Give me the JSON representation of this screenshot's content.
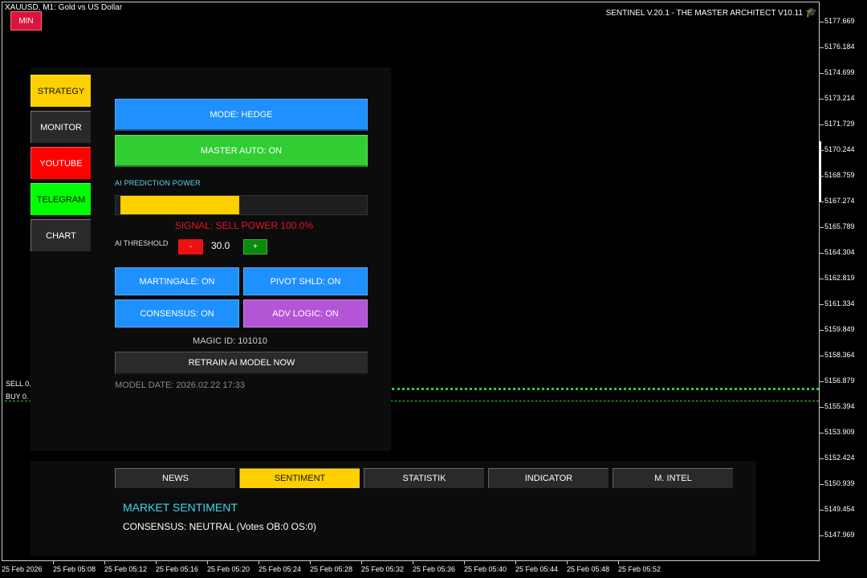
{
  "header": {
    "symbol": "XAUUSD, M1:  Gold vs US Dollar",
    "title": "SENTINEL V.20.1 - THE MASTER ARCHITECT V10.11",
    "title_icon": "graduation-cap-icon",
    "min_label": "MIN"
  },
  "price_axis": [
    "5177.669",
    "5176.184",
    "5174.699",
    "5173.214",
    "5171.729",
    "5170.244",
    "5168.759",
    "5167.274",
    "5165.789",
    "5164.304",
    "5162.819",
    "5161.334",
    "5159.849",
    "5158.364",
    "5156.879",
    "5155.394",
    "5153.909",
    "5152.424",
    "5150.939",
    "5149.454",
    "5147.969"
  ],
  "time_axis": [
    "25 Feb 2026",
    "25 Feb 05:08",
    "25 Feb 05:12",
    "25 Feb 05:16",
    "25 Feb 05:20",
    "25 Feb 05:24",
    "25 Feb 05:28",
    "25 Feb 05:32",
    "25 Feb 05:36",
    "25 Feb 05:40",
    "25 Feb 05:44",
    "25 Feb 05:48",
    "25 Feb 05:52"
  ],
  "chart_lines": {
    "sell_label": "SELL 0.",
    "buy_label": "BUY 0."
  },
  "sidebar": {
    "items": [
      {
        "label": "STRATEGY",
        "bg": "#ffd000",
        "fg": "#111111"
      },
      {
        "label": "MONITOR",
        "bg": "#2a2a2a",
        "fg": "#ffffff"
      },
      {
        "label": "YOUTUBE",
        "bg": "#ff0000",
        "fg": "#ffffff"
      },
      {
        "label": "TELEGRAM",
        "bg": "#00ff00",
        "fg": "#111111"
      },
      {
        "label": "CHART",
        "bg": "#2a2a2a",
        "fg": "#ffffff"
      }
    ]
  },
  "strategy": {
    "mode_label": "MODE: HEDGE",
    "master_auto_label": "MASTER AUTO: ON",
    "ai_power_label": "AI PREDICTION POWER",
    "ai_power_fraction": 0.47,
    "signal_text": "SIGNAL: SELL POWER 100.0%",
    "threshold_label": "AI THRESHOLD",
    "minus_label": "-",
    "threshold_value": "30.0",
    "plus_label": "+",
    "toggles": [
      {
        "label": "MARTINGALE: ON",
        "bg": "#1e90ff"
      },
      {
        "label": "PIVOT SHLD: ON",
        "bg": "#1e90ff"
      },
      {
        "label": "CONSENSUS: ON",
        "bg": "#1e90ff"
      },
      {
        "label": "ADV LOGIC: ON",
        "bg": "#b455d6"
      }
    ],
    "magic_id": "MAGIC ID: 101010",
    "retrain_label": "RETRAIN AI MODEL NOW",
    "model_date": "MODEL DATE: 2026.02.22 17:33"
  },
  "bottom": {
    "tabs": [
      {
        "label": "NEWS",
        "active": false
      },
      {
        "label": "SENTIMENT",
        "active": true
      },
      {
        "label": "STATISTIK",
        "active": false
      },
      {
        "label": "INDICATOR",
        "active": false
      },
      {
        "label": "M. INTEL",
        "active": false
      }
    ],
    "section_title": "MARKET SENTIMENT",
    "consensus_text": "CONSENSUS: NEUTRAL (Votes OB:0 OS:0)"
  },
  "colors": {
    "blue": "#1e90ff",
    "green": "#32cd32",
    "yellow": "#ffd000",
    "tab_bg": "#2a2a2a"
  }
}
